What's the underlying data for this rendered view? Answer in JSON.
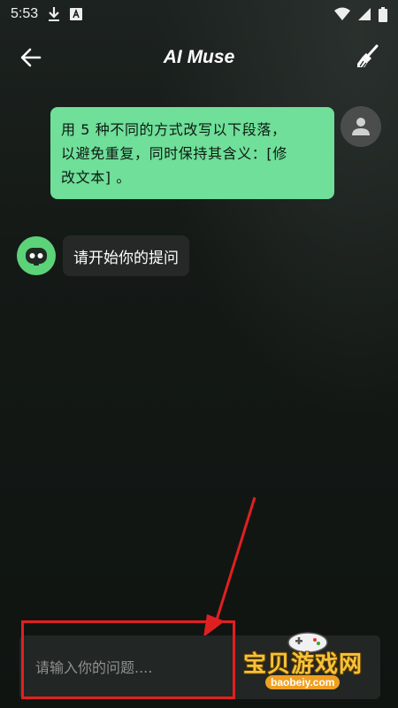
{
  "status_bar": {
    "time": "5:53",
    "icons": [
      "download-icon",
      "a-box-icon",
      "wifi-icon",
      "signal-icon",
      "battery-icon"
    ]
  },
  "app_bar": {
    "title": "AI Muse",
    "back_icon": "arrow-left-icon",
    "clear_icon": "broom-icon"
  },
  "messages": [
    {
      "role": "user",
      "lines": [
        "用 5 种不同的方式改写以下段落，",
        "以避免重复，同时保持其含义：[修",
        "改文本] 。"
      ]
    },
    {
      "role": "bot",
      "text": "请开始你的提问"
    }
  ],
  "input": {
    "placeholder": "请输入你的问题...."
  },
  "watermark": {
    "text": "宝贝游戏网",
    "url": "baobeiy.com"
  },
  "colors": {
    "user_bubble": "#6fdf99",
    "bot_avatar": "#5cd279",
    "highlight": "#e02020"
  }
}
